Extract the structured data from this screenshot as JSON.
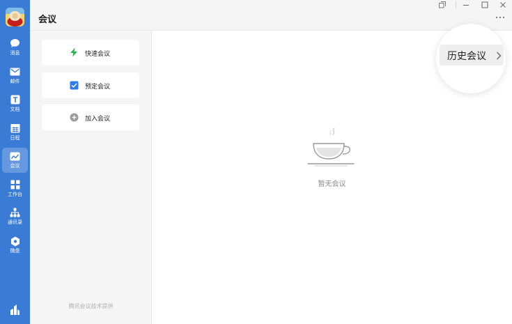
{
  "app": {
    "title": "会议"
  },
  "sidebar": {
    "items": [
      {
        "label": "消息",
        "icon": "chat-bubble-icon"
      },
      {
        "label": "邮件",
        "icon": "mail-icon"
      },
      {
        "label": "文档",
        "icon": "document-icon"
      },
      {
        "label": "日程",
        "icon": "calendar-icon"
      },
      {
        "label": "会议",
        "icon": "meeting-icon"
      },
      {
        "label": "工作台",
        "icon": "workbench-icon"
      },
      {
        "label": "通讯录",
        "icon": "contacts-icon"
      },
      {
        "label": "微盘",
        "icon": "cloud-disk-icon"
      }
    ],
    "active": "会议",
    "bottom_icon": "app-logo-icon"
  },
  "actions": [
    {
      "label": "快速会议",
      "icon": "lightning-icon",
      "color": "#2bb24c"
    },
    {
      "label": "预定会议",
      "icon": "checkbox-icon",
      "color": "#2f7be8"
    },
    {
      "label": "加入会议",
      "icon": "plus-circle-icon",
      "color": "#9a9a9a"
    }
  ],
  "panel": {
    "footer": "腾讯会议技术提供"
  },
  "main": {
    "empty_text": "暂无会议",
    "history_label": "历史会议"
  },
  "colors": {
    "sidebar": "#3a7bd5",
    "accent": "#2f7be8",
    "quick": "#2bb24c"
  }
}
